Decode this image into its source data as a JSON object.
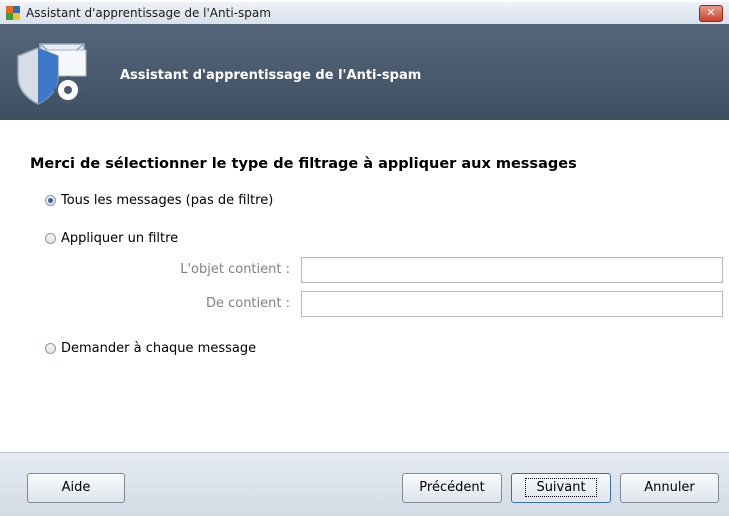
{
  "window": {
    "title": "Assistant d'apprentissage de l'Anti-spam",
    "close_glyph": "✕"
  },
  "header": {
    "title": "Assistant d'apprentissage de l'Anti-spam",
    "icon": "shield-mail-gear-icon"
  },
  "content": {
    "heading": "Merci de sélectionner le type de filtrage à appliquer aux messages",
    "options": [
      {
        "label": "Tous les messages (pas de filtre)",
        "checked": true
      },
      {
        "label": "Appliquer un filtre",
        "checked": false
      },
      {
        "label": "Demander à chaque message",
        "checked": false
      }
    ],
    "fields": {
      "subject_label": "L'objet contient :",
      "subject_value": "",
      "from_label": "De contient :",
      "from_value": ""
    }
  },
  "footer": {
    "help": "Aide",
    "previous": "Précédent",
    "next": "Suivant",
    "cancel": "Annuler"
  },
  "colors": {
    "header_bg": "#4b5b6e",
    "accent": "#3a5fa8",
    "footer_bg": "#dde4ec"
  }
}
